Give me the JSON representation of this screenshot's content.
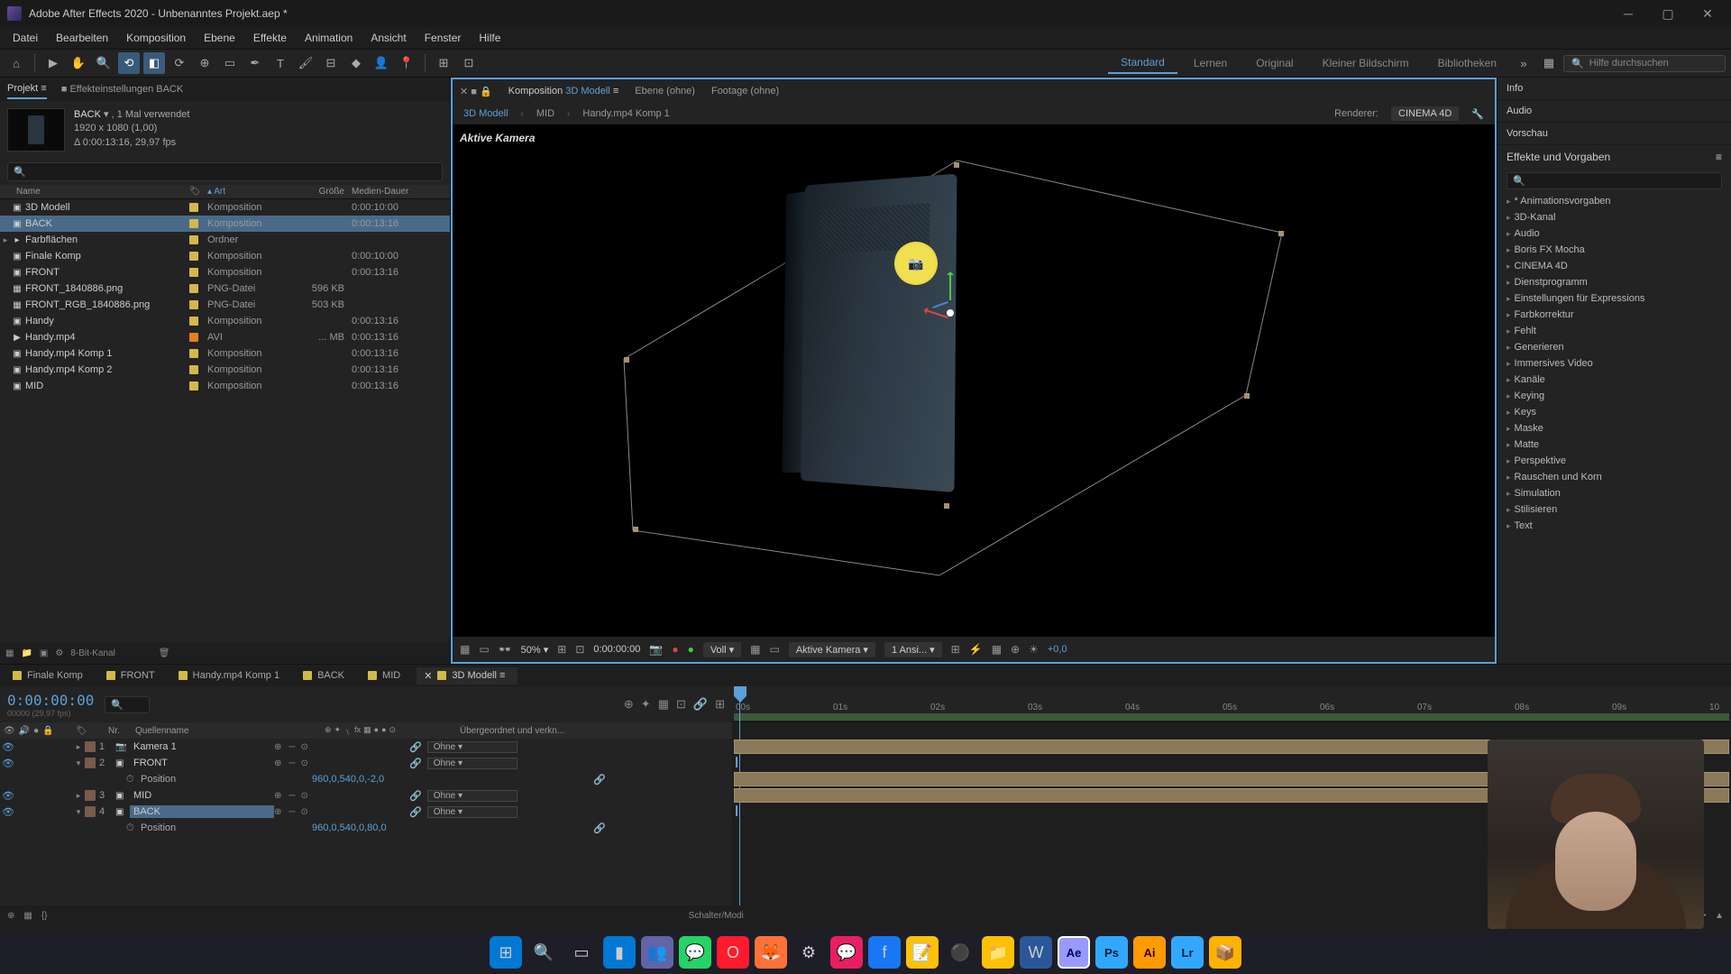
{
  "title": "Adobe After Effects 2020 - Unbenanntes Projekt.aep *",
  "menu": [
    "Datei",
    "Bearbeiten",
    "Komposition",
    "Ebene",
    "Effekte",
    "Animation",
    "Ansicht",
    "Fenster",
    "Hilfe"
  ],
  "workspaces": [
    "Standard",
    "Lernen",
    "Original",
    "Kleiner Bildschirm",
    "Bibliotheken"
  ],
  "active_workspace": "Standard",
  "search_help": "Hilfe durchsuchen",
  "project": {
    "tab_project": "Projekt",
    "tab_effect_settings": "Effekteinstellungen  BACK",
    "selected": {
      "name": "BACK",
      "usage": "1 Mal verwendet",
      "dims": "1920 x 1080 (1,00)",
      "duration": "Δ 0:00:13:16, 29,97 fps"
    },
    "columns": {
      "name": "Name",
      "tag": "",
      "art": "Art",
      "size": "Größe",
      "dur": "Medien-Dauer"
    },
    "items": [
      {
        "icon": "▣",
        "name": "3D Modell",
        "art": "Komposition",
        "size": "",
        "dur": "0:00:10:00",
        "tag": true
      },
      {
        "icon": "▣",
        "name": "BACK",
        "art": "Komposition",
        "size": "",
        "dur": "0:00:13:16",
        "tag": true,
        "sel": true
      },
      {
        "icon": "▸",
        "name": "Farbflächen",
        "art": "Ordner",
        "size": "",
        "dur": "",
        "tag": true,
        "folder": true
      },
      {
        "icon": "▣",
        "name": "Finale Komp",
        "art": "Komposition",
        "size": "",
        "dur": "0:00:10:00",
        "tag": true
      },
      {
        "icon": "▣",
        "name": "FRONT",
        "art": "Komposition",
        "size": "",
        "dur": "0:00:13:16",
        "tag": true
      },
      {
        "icon": "▦",
        "name": "FRONT_1840886.png",
        "art": "PNG-Datei",
        "size": "596 KB",
        "dur": "",
        "tag": true
      },
      {
        "icon": "▦",
        "name": "FRONT_RGB_1840886.png",
        "art": "PNG-Datei",
        "size": "503 KB",
        "dur": "",
        "tag": true
      },
      {
        "icon": "▣",
        "name": "Handy",
        "art": "Komposition",
        "size": "",
        "dur": "0:00:13:16",
        "tag": true
      },
      {
        "icon": "▶",
        "name": "Handy.mp4",
        "art": "AVI",
        "size": "... MB",
        "dur": "0:00:13:16",
        "tag": true,
        "orange": true
      },
      {
        "icon": "▣",
        "name": "Handy.mp4 Komp 1",
        "art": "Komposition",
        "size": "",
        "dur": "0:00:13:16",
        "tag": true
      },
      {
        "icon": "▣",
        "name": "Handy.mp4 Komp 2",
        "art": "Komposition",
        "size": "",
        "dur": "0:00:13:16",
        "tag": true
      },
      {
        "icon": "▣",
        "name": "MID",
        "art": "Komposition",
        "size": "",
        "dur": "0:00:13:16",
        "tag": true
      }
    ],
    "footer_bit": "8-Bit-Kanal"
  },
  "comp": {
    "tab_comp_prefix": "Komposition",
    "tab_comp_name": "3D Modell",
    "tab_layer": "Ebene  (ohne)",
    "tab_footage": "Footage  (ohne)",
    "breadcrumb": [
      "3D Modell",
      "MID",
      "Handy.mp4 Komp 1"
    ],
    "renderer_label": "Renderer:",
    "renderer_value": "CINEMA 4D",
    "cam_label": "Aktive Kamera",
    "footer": {
      "zoom": "50%",
      "timecode": "0:00:00:00",
      "res": "Voll",
      "view": "Aktive Kamera",
      "views": "1 Ansi...",
      "exposure": "+0,0"
    }
  },
  "right": {
    "info": "Info",
    "audio": "Audio",
    "preview": "Vorschau",
    "effects_presets": "Effekte und Vorgaben",
    "categories": [
      "* Animationsvorgaben",
      "3D-Kanal",
      "Audio",
      "Boris FX Mocha",
      "CINEMA 4D",
      "Dienstprogramm",
      "Einstellungen für Expressions",
      "Farbkorrektur",
      "Fehlt",
      "Generieren",
      "Immersives Video",
      "Kanäle",
      "Keying",
      "Keys",
      "Maske",
      "Matte",
      "Perspektive",
      "Rauschen und Korn",
      "Simulation",
      "Stilisieren",
      "Text"
    ]
  },
  "timeline": {
    "tabs": [
      "Finale Komp",
      "FRONT",
      "Handy.mp4 Komp 1",
      "BACK",
      "MID",
      "3D Modell"
    ],
    "active_tab": "3D Modell",
    "timecode": "0:00:00:00",
    "sub_tc": "00000 (29,97 fps)",
    "col_nr": "Nr.",
    "col_source": "Quellenname",
    "col_parent": "Übergeordnet und verkn...",
    "parent_none": "Ohne",
    "layers": [
      {
        "num": "1",
        "icon": "📷",
        "name": "Kamera 1",
        "color": "#7a5a4a",
        "parent": "Ohne"
      },
      {
        "num": "2",
        "icon": "▣",
        "name": "FRONT",
        "color": "#7a5a4a",
        "parent": "Ohne",
        "sel": false,
        "open": true,
        "prop": "Position",
        "pval": "960,0,540,0,-2,0"
      },
      {
        "num": "3",
        "icon": "▣",
        "name": "MID",
        "color": "#7a5a4a",
        "parent": "Ohne"
      },
      {
        "num": "4",
        "icon": "▣",
        "name": "BACK",
        "color": "#7a5a4a",
        "parent": "Ohne",
        "sel": true,
        "open": true,
        "prop": "Position",
        "pval": "960,0,540,0,80,0"
      }
    ],
    "ticks": [
      "00s",
      "01s",
      "02s",
      "03s",
      "04s",
      "05s",
      "06s",
      "07s",
      "08s",
      "09s",
      "10"
    ],
    "footer": "Schalter/Modi"
  },
  "taskbar_icons": [
    "win",
    "search",
    "tasks",
    "vscode",
    "teams",
    "whatsapp",
    "opera",
    "firefox",
    "app1",
    "messenger",
    "facebook",
    "notes",
    "obs",
    "explorer",
    "word",
    "ae",
    "ps",
    "ai",
    "lr",
    "app2"
  ]
}
